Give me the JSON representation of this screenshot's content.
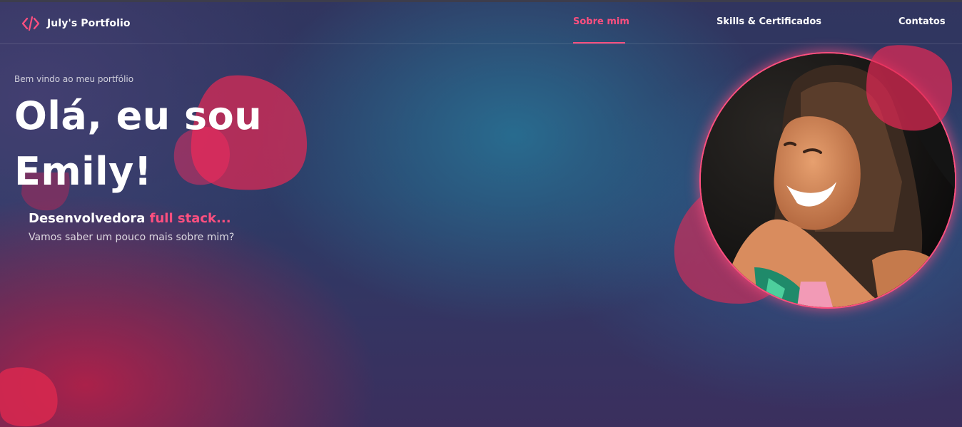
{
  "nav": {
    "brand": "July's Portfolio",
    "items": [
      {
        "label": "Sobre mim",
        "active": true
      },
      {
        "label": "Skills & Certificados",
        "active": false
      },
      {
        "label": "Contatos",
        "active": false
      }
    ]
  },
  "hero": {
    "eyebrow": "Bem vindo ao meu portfólio",
    "line1": "Olá, eu sou",
    "line2": "Emily!",
    "role_prefix": "Desenvolvedora",
    "role_accent": "full stack...",
    "subtitle": "Vamos saber um pouco mais sobre mim?"
  },
  "icons": {
    "brand_icon": "code-icon"
  },
  "colors": {
    "accent": "#ff4f7f",
    "background_dark": "#2b3a63",
    "blob": "#e02a55"
  }
}
